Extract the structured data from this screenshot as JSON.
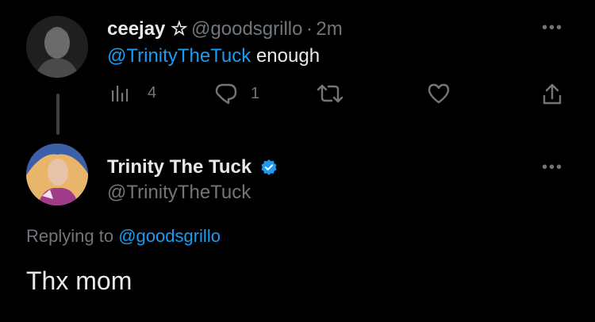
{
  "tweet1": {
    "display_name": "ceejay ☆",
    "handle": "@goodsgrillo",
    "separator": "·",
    "time": "2m",
    "mention": "@TrinityTheTuck",
    "text": "enough",
    "views_count": "4",
    "reply_count": "1"
  },
  "tweet2": {
    "display_name": "Trinity The Tuck",
    "handle": "@TrinityTheTuck",
    "replying_prefix": "Replying to",
    "replying_to": "@goodsgrillo",
    "text": "Thx mom"
  },
  "colors": {
    "background": "#000000",
    "text_primary": "#e7e9ea",
    "text_muted": "#71767b",
    "accent": "#1d9bf0"
  },
  "icons": [
    "more-icon",
    "views-icon",
    "reply-icon",
    "retweet-icon",
    "like-icon",
    "share-icon",
    "verified-icon"
  ]
}
